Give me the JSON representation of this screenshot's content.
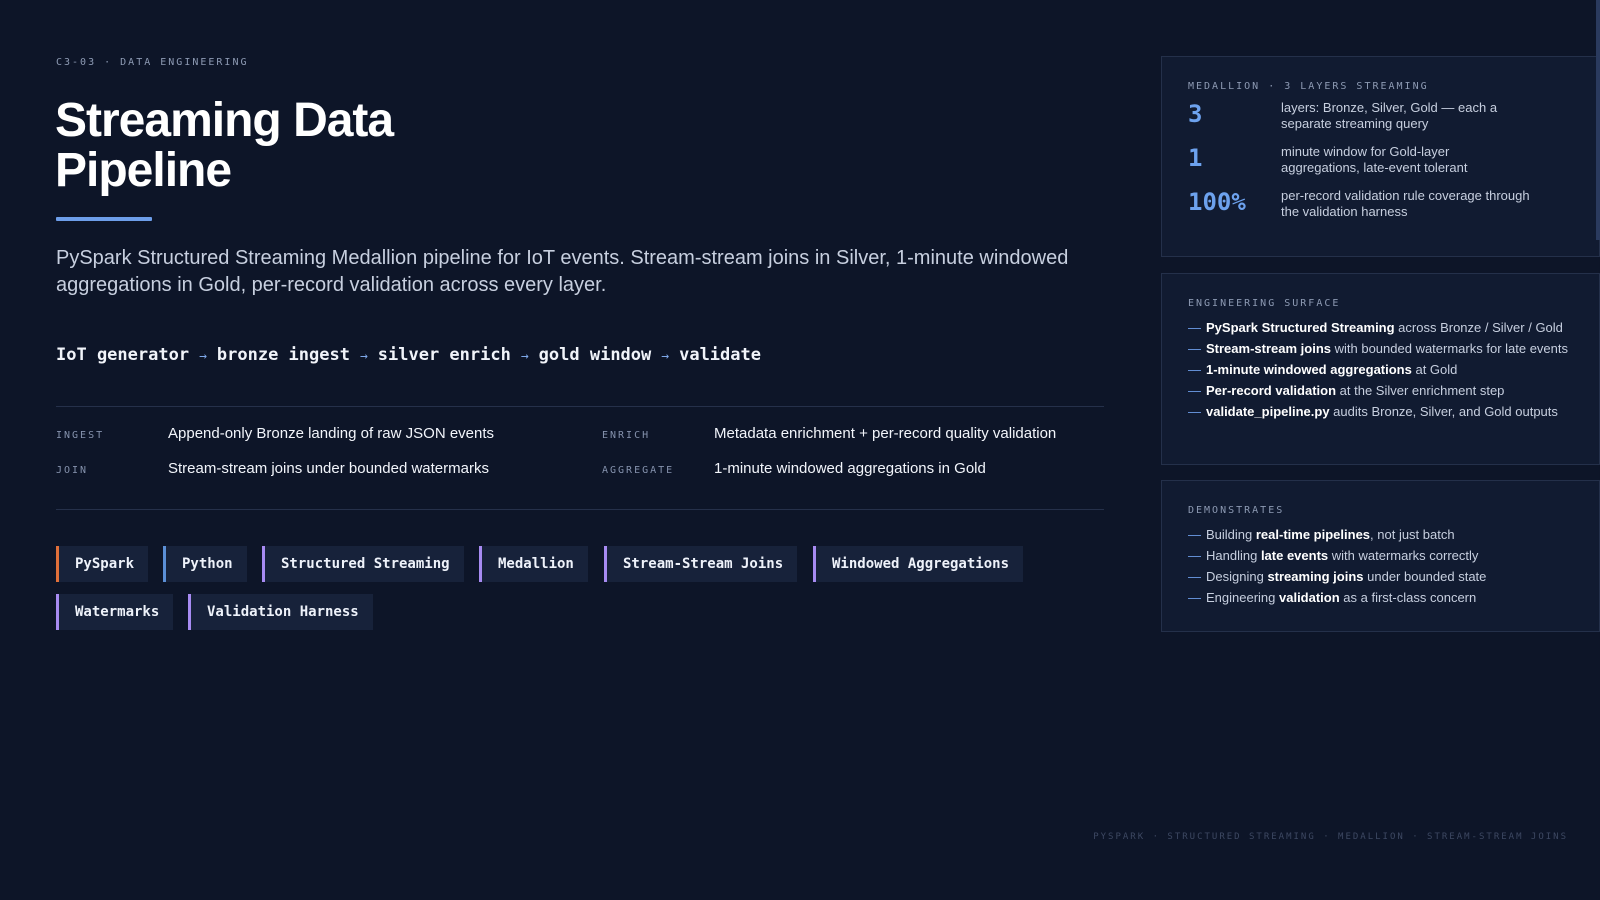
{
  "eyebrow": "C3-03 · DATA ENGINEERING",
  "title": "Streaming Data Pipeline",
  "lede": "PySpark Structured Streaming Medallion pipeline for IoT events. Stream-stream joins in Silver, 1-minute windowed aggregations in Gold, per-record validation across every layer.",
  "flow": {
    "steps": [
      "IoT generator",
      "bronze ingest",
      "silver enrich",
      "gold window",
      "validate"
    ],
    "arrow": "→"
  },
  "facts": [
    {
      "label": "INGEST",
      "text": "Append-only Bronze landing of raw JSON events"
    },
    {
      "label": "ENRICH",
      "text": "Metadata enrichment + per-record quality validation"
    },
    {
      "label": "JOIN",
      "text": "Stream-stream joins under bounded watermarks"
    },
    {
      "label": "AGGREGATE",
      "text": "1-minute windowed aggregations in Gold"
    }
  ],
  "tags": [
    {
      "label": "PySpark",
      "accent": "#e0703a"
    },
    {
      "label": "Python",
      "accent": "#5b8fd6"
    },
    {
      "label": "Structured Streaming",
      "accent": "#a78bf2"
    },
    {
      "label": "Medallion",
      "accent": "#a78bf2"
    },
    {
      "label": "Stream-Stream Joins",
      "accent": "#a78bf2"
    },
    {
      "label": "Windowed Aggregations",
      "accent": "#a78bf2"
    },
    {
      "label": "Watermarks",
      "accent": "#a78bf2"
    },
    {
      "label": "Validation Harness",
      "accent": "#a78bf2"
    }
  ],
  "medallion": {
    "eyebrow": "MEDALLION · 3 LAYERS STREAMING",
    "stats": [
      {
        "value": "3",
        "text": "layers: Bronze, Silver, Gold — each a separate streaming query"
      },
      {
        "value": "1",
        "text": "minute window for Gold-layer aggregations, late-event tolerant"
      },
      {
        "value": "100%",
        "text": "per-record validation rule coverage through the validation harness"
      }
    ]
  },
  "engineering": {
    "eyebrow": "ENGINEERING SURFACE",
    "items": [
      {
        "bold": "PySpark Structured Streaming",
        "rest": " across Bronze / Silver / Gold"
      },
      {
        "bold": "Stream-stream joins",
        "rest": " with bounded watermarks for late events"
      },
      {
        "bold": "1-minute windowed aggregations",
        "rest": " at Gold"
      },
      {
        "bold": "Per-record validation",
        "rest": " at the Silver enrichment step"
      },
      {
        "bold": "validate_pipeline.py",
        "rest": " audits Bronze, Silver, and Gold outputs"
      }
    ]
  },
  "demonstrates": {
    "eyebrow": "DEMONSTRATES",
    "items": [
      {
        "pre": "Building ",
        "bold": "real-time pipelines",
        "rest": ", not just batch"
      },
      {
        "pre": "Handling ",
        "bold": "late events",
        "rest": " with watermarks correctly"
      },
      {
        "pre": "Designing ",
        "bold": "streaming joins",
        "rest": " under bounded state"
      },
      {
        "pre": "Engineering ",
        "bold": "validation",
        "rest": " as a first-class concern"
      }
    ]
  },
  "footer": "PYSPARK · STRUCTURED STREAMING · MEDALLION · STREAM-STREAM JOINS",
  "colors": {
    "background": "#0d1528",
    "accent": "#6d9eea",
    "panel": "#111b31"
  }
}
